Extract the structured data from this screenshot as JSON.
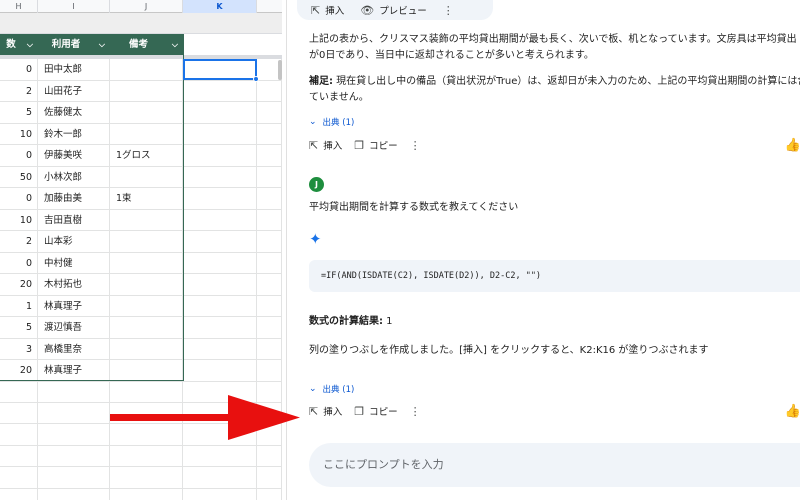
{
  "sheet": {
    "columns": [
      {
        "letter": "H",
        "selected": false
      },
      {
        "letter": "I",
        "selected": false
      },
      {
        "letter": "J",
        "selected": false
      },
      {
        "letter": "K",
        "selected": true
      }
    ],
    "headers": [
      {
        "label": "数"
      },
      {
        "label": "利用者"
      },
      {
        "label": "備考"
      }
    ],
    "rows": [
      {
        "count": "0",
        "user": "田中太郎",
        "note": ""
      },
      {
        "count": "2",
        "user": "山田花子",
        "note": ""
      },
      {
        "count": "5",
        "user": "佐藤健太",
        "note": ""
      },
      {
        "count": "10",
        "user": "鈴木一郎",
        "note": ""
      },
      {
        "count": "0",
        "user": "伊藤美咲",
        "note": "1グロス"
      },
      {
        "count": "50",
        "user": "小林次郎",
        "note": ""
      },
      {
        "count": "0",
        "user": "加藤由美",
        "note": "1束"
      },
      {
        "count": "10",
        "user": "吉田直樹",
        "note": ""
      },
      {
        "count": "2",
        "user": "山本彩",
        "note": ""
      },
      {
        "count": "0",
        "user": "中村健",
        "note": ""
      },
      {
        "count": "20",
        "user": "木村拓也",
        "note": ""
      },
      {
        "count": "1",
        "user": "林真理子",
        "note": ""
      },
      {
        "count": "5",
        "user": "渡辺慎吾",
        "note": ""
      },
      {
        "count": "3",
        "user": "高橋里奈",
        "note": ""
      },
      {
        "count": "20",
        "user": "林真理子",
        "note": ""
      }
    ],
    "colors": {
      "header_bg": "#356854",
      "selection": "#1a73e8"
    }
  },
  "panel": {
    "top_actions": {
      "insert": "挿入",
      "preview": "プレビュー"
    },
    "para1_line1": "上記の表から、クリスマス装飾の平均貸出期間が最も長く、次いで板、机となっています。文房具は平均貸出",
    "para1_line2": "が0日であり、当日中に返却されることが多いと考えられます。",
    "note_label": "補足:",
    "note_line1": " 現在貸し出し中の備品（貸出状況がTrue）は、返却日が未入力のため、上記の平均貸出期間の計算には含",
    "note_line2": "ていません。",
    "sources1": "出典 (1)",
    "actions1": {
      "insert": "挿入",
      "copy": "コピー"
    },
    "user_initial": "J",
    "user_question": "平均貸出期間を計算する数式を教えてください",
    "formula": "=IF(AND(ISDATE(C2), ISDATE(D2)), D2-C2, \"\")",
    "result_label": "数式の計算結果:",
    "result_value": " 1",
    "result_desc": "列の塗りつぶしを作成しました。[挿入] をクリックすると、K2:K16 が塗りつぶされます",
    "sources2": "出典 (1)",
    "actions2": {
      "insert": "挿入",
      "copy": "コピー"
    },
    "prompt_placeholder": "ここにプロンプトを入力",
    "icons": [
      "insert-icon",
      "preview-eye-icon",
      "more-vert-icon",
      "copy-icon",
      "thumb-up-icon",
      "sparkle-icon",
      "chevron-down-icon"
    ]
  },
  "annotation": {
    "arrow_color": "#e8100f"
  }
}
